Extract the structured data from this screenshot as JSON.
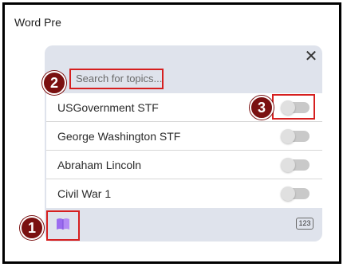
{
  "header": {
    "title": "Word Pre"
  },
  "panel": {
    "close_icon": "close-icon",
    "search": {
      "placeholder": "Search for topics..."
    },
    "topics": [
      {
        "label": "USGovernment STF",
        "enabled": false
      },
      {
        "label": "George Washington STF",
        "enabled": false
      },
      {
        "label": "Abraham Lincoln",
        "enabled": false
      },
      {
        "label": "Civil War 1",
        "enabled": false
      }
    ],
    "footer": {
      "book_icon": "book-icon",
      "numbers_label": "123"
    }
  },
  "callouts": [
    "1",
    "2",
    "3"
  ],
  "colors": {
    "panel_bg": "#dfe3ec",
    "highlight": "#d61f1f",
    "badge": "#7a1010",
    "book_icon": "#9b6cf0"
  }
}
